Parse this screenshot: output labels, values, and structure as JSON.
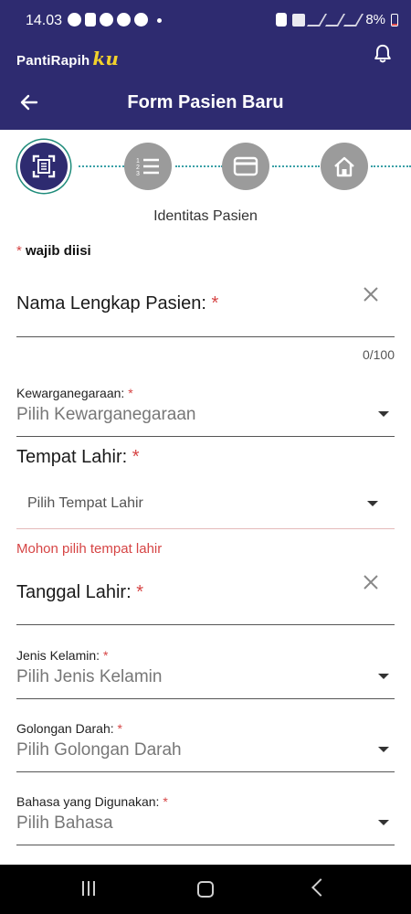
{
  "status_bar": {
    "time": "14.03",
    "battery": "8%"
  },
  "app": {
    "brand_name": "PantiRapih",
    "brand_suffix": "ku"
  },
  "header": {
    "title": "Form Pasien Baru"
  },
  "stepper": {
    "current_step_label": "Identitas Pasien"
  },
  "form": {
    "required_mark": "*",
    "required_note": "wajib diisi",
    "nama_lengkap": {
      "label": "Nama Lengkap Pasien:",
      "counter": "0/100"
    },
    "kewarganegaraan": {
      "label": "Kewarganegaraan:",
      "placeholder": "Pilih Kewarganegaraan"
    },
    "tempat_lahir": {
      "label": "Tempat Lahir:",
      "placeholder": "Pilih Tempat Lahir",
      "error": "Mohon pilih tempat lahir"
    },
    "tanggal_lahir": {
      "label": "Tanggal Lahir:"
    },
    "jenis_kelamin": {
      "label": "Jenis Kelamin:",
      "placeholder": "Pilih Jenis Kelamin"
    },
    "golongan_darah": {
      "label": "Golongan Darah:",
      "placeholder": "Pilih Golongan Darah"
    },
    "bahasa": {
      "label": "Bahasa yang Digunakan:",
      "placeholder": "Pilih Bahasa"
    }
  },
  "colors": {
    "primary": "#2e2b70",
    "accent_yellow": "#f2d12b",
    "error": "#d64545",
    "step_inactive": "#9b9b9b",
    "connector": "#3aa0a6"
  },
  "icons": [
    "back-arrow-icon",
    "bell-icon",
    "scan-icon",
    "list-icon",
    "card-icon",
    "home-icon",
    "close-icon",
    "chevron-down-icon"
  ]
}
